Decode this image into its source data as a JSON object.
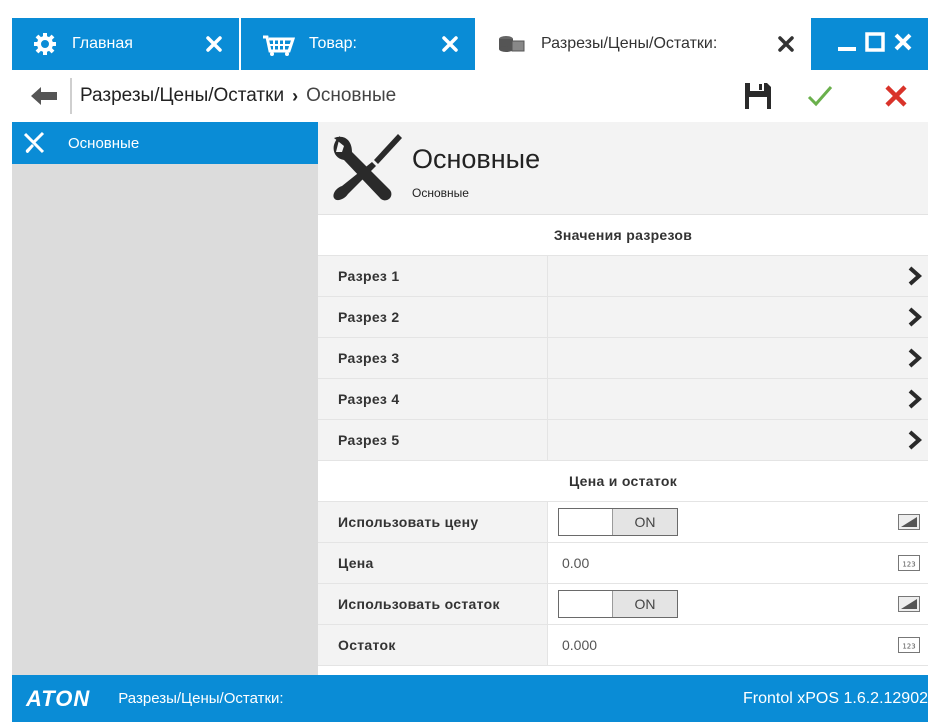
{
  "tabs": [
    {
      "label": "Главная",
      "icon": "gear-icon"
    },
    {
      "label": "Товар:",
      "icon": "basket-icon"
    },
    {
      "label": "Разрезы/Цены/Остатки:",
      "icon": "cubes-icon"
    }
  ],
  "breadcrumb": {
    "parent": "Разрезы/Цены/Остатки",
    "separator": "›",
    "current": "Основные"
  },
  "sidebar": {
    "items": [
      {
        "label": "Основные",
        "icon": "tools-icon"
      }
    ]
  },
  "header": {
    "title": "Основные",
    "subtitle": "Основные"
  },
  "sections": {
    "cuts": {
      "title": "Значения разрезов",
      "rows": [
        {
          "label": "Разрез 1",
          "value": ""
        },
        {
          "label": "Разрез 2",
          "value": ""
        },
        {
          "label": "Разрез 3",
          "value": ""
        },
        {
          "label": "Разрез 4",
          "value": ""
        },
        {
          "label": "Разрез 5",
          "value": ""
        }
      ]
    },
    "price": {
      "title": "Цена и остаток",
      "use_price": {
        "label": "Использовать цену",
        "toggle": "ON"
      },
      "price": {
        "label": "Цена",
        "value": "0.00"
      },
      "use_stock": {
        "label": "Использовать остаток",
        "toggle": "ON"
      },
      "stock": {
        "label": "Остаток",
        "value": "0.000"
      }
    }
  },
  "status": {
    "logo": "ATON",
    "text": "Разрезы/Цены/Остатки:",
    "version": "Frontol xPOS 1.6.2.12902"
  },
  "colors": {
    "accent": "#0a8cd6",
    "confirm": "#6ab04c",
    "cancel": "#d9332a"
  }
}
